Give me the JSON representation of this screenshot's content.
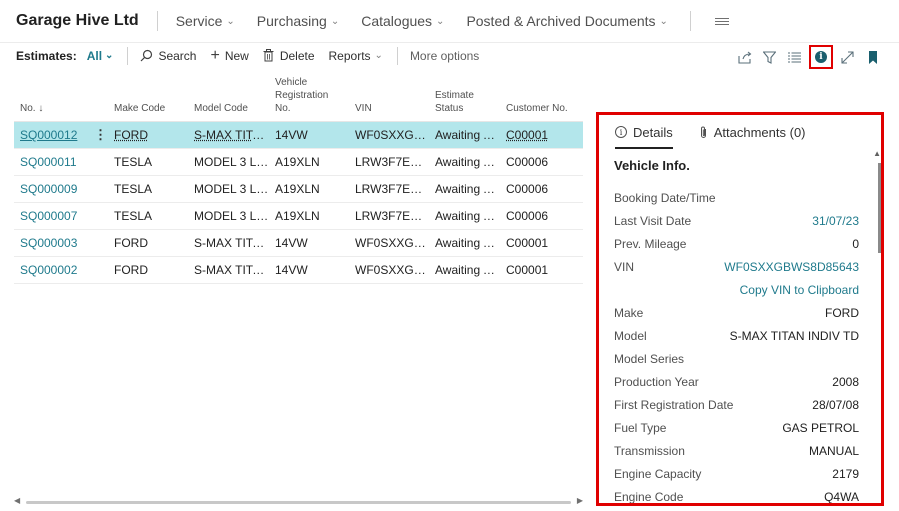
{
  "app": {
    "company": "Garage Hive Ltd",
    "nav": [
      {
        "label": "Service"
      },
      {
        "label": "Purchasing"
      },
      {
        "label": "Catalogues"
      },
      {
        "label": "Posted & Archived Documents"
      }
    ]
  },
  "actionbar": {
    "title": "Estimates:",
    "filter": "All",
    "search": "Search",
    "new": "New",
    "delete": "Delete",
    "reports": "Reports",
    "more": "More options",
    "icons": [
      "share-icon",
      "filter-icon",
      "list-view-icon",
      "info-icon",
      "expand-icon",
      "bookmark-icon"
    ]
  },
  "grid": {
    "headers": {
      "no": "No. ↓",
      "make": "Make Code",
      "model": "Model Code",
      "reg1": "Vehicle",
      "reg2": "Registration",
      "reg3": "No.",
      "vin": "VIN",
      "status1": "Estimate",
      "status2": "Status",
      "customer": "Customer No."
    },
    "rows": [
      {
        "no": "SQ000012",
        "make": "FORD",
        "model": "S-MAX TITAN...",
        "reg": "14VW",
        "vin": "WF0SXXGBW...",
        "status": "Awaiting A...",
        "customer": "C00001"
      },
      {
        "no": "SQ000011",
        "make": "TESLA",
        "model": "MODEL 3 LO...",
        "reg": "A19XLN",
        "vin": "LRW3F7EB5...",
        "status": "Awaiting A...",
        "customer": "C00006"
      },
      {
        "no": "SQ000009",
        "make": "TESLA",
        "model": "MODEL 3 LO...",
        "reg": "A19XLN",
        "vin": "LRW3F7EB5...",
        "status": "Awaiting A...",
        "customer": "C00006"
      },
      {
        "no": "SQ000007",
        "make": "TESLA",
        "model": "MODEL 3 LO...",
        "reg": "A19XLN",
        "vin": "LRW3F7EB5...",
        "status": "Awaiting A...",
        "customer": "C00006"
      },
      {
        "no": "SQ000003",
        "make": "FORD",
        "model": "S-MAX TITAN...",
        "reg": "14VW",
        "vin": "WF0SXXGBW...",
        "status": "Awaiting A...",
        "customer": "C00001"
      },
      {
        "no": "SQ000002",
        "make": "FORD",
        "model": "S-MAX TITAN...",
        "reg": "14VW",
        "vin": "WF0SXXGBW...",
        "status": "Awaiting A...",
        "customer": "C00001"
      }
    ]
  },
  "factbox": {
    "tab_details": "Details",
    "tab_attachments": "Attachments (0)",
    "section": "Vehicle Info.",
    "fields": [
      {
        "label": "Booking Date/Time",
        "value": ""
      },
      {
        "label": "Last Visit Date",
        "value": "31/07/23"
      },
      {
        "label": "Prev. Mileage",
        "value": "0"
      },
      {
        "label": "VIN",
        "value": "WF0SXXGBWS8D85643"
      },
      {
        "label": "",
        "value": "Copy VIN to Clipboard"
      },
      {
        "label": "Make",
        "value": "FORD"
      },
      {
        "label": "Model",
        "value": "S-MAX TITAN INDIV TD"
      },
      {
        "label": "Model Series",
        "value": ""
      },
      {
        "label": "Production Year",
        "value": "2008"
      },
      {
        "label": "First Registration Date",
        "value": "28/07/08"
      },
      {
        "label": "Fuel Type",
        "value": "GAS PETROL"
      },
      {
        "label": "Transmission",
        "value": "MANUAL"
      },
      {
        "label": "Engine Capacity",
        "value": "2179"
      },
      {
        "label": "Engine Code",
        "value": "Q4WA"
      }
    ]
  },
  "colors": {
    "accent": "#1f7a8c",
    "selected_row": "#b3e6eb",
    "highlight": "#e00000"
  }
}
